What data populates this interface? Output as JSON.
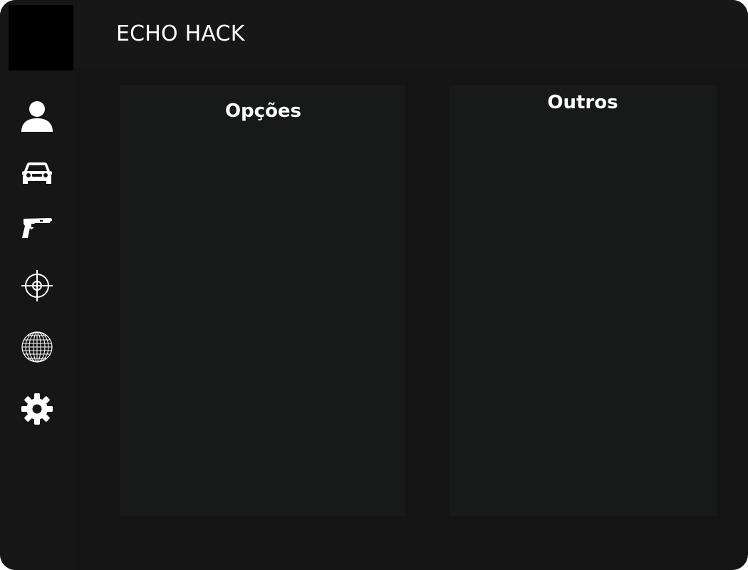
{
  "app": {
    "title": "ECHO HACK"
  },
  "sidebar": {
    "items": [
      {
        "name": "player",
        "icon": "user-icon"
      },
      {
        "name": "vehicle",
        "icon": "car-icon"
      },
      {
        "name": "weapons",
        "icon": "pistol-icon"
      },
      {
        "name": "aim",
        "icon": "crosshair-icon"
      },
      {
        "name": "world",
        "icon": "globe-icon"
      },
      {
        "name": "settings",
        "icon": "gear-icon"
      }
    ]
  },
  "panels": {
    "options": {
      "title": "Opções"
    },
    "others": {
      "title": "Outros"
    }
  },
  "colors": {
    "window_background": "#141414",
    "sidebar_background": "#161616",
    "header_background": "#171717",
    "panel_background": "#181a1a",
    "logo_background": "#000000",
    "text": "#ffffff"
  }
}
